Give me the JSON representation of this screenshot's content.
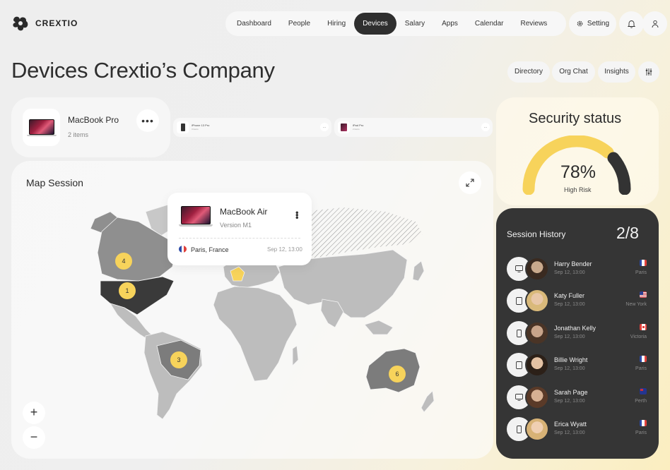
{
  "brand": {
    "name": "CREXTIO"
  },
  "nav": {
    "items": [
      "Dashboard",
      "People",
      "Hiring",
      "Devices",
      "Salary",
      "Apps",
      "Calendar",
      "Reviews"
    ],
    "active": "Devices",
    "setting_label": "Setting",
    "icons": [
      "gear-icon",
      "bell-icon",
      "user-icon"
    ]
  },
  "page": {
    "title": "Devices Crextio’s Company",
    "chips": [
      "Directory",
      "Org Chat",
      "Insights"
    ]
  },
  "device": {
    "name": "MacBook Pro",
    "count": "2 items"
  },
  "small_devices": [
    {
      "name": "iPhone 13 Pro",
      "sub": "3 items"
    },
    {
      "name": "iPad Pro",
      "sub": "2 items"
    }
  ],
  "map": {
    "title": "Map Session",
    "popup": {
      "name": "MacBook Air",
      "version": "Version M1",
      "city": "Paris, France",
      "date": "Sep 12, 13:00"
    },
    "markers": [
      "4",
      "1",
      "3",
      "6"
    ],
    "zoom_in": "+",
    "zoom_out": "−"
  },
  "security": {
    "title": "Security status",
    "value": "78%",
    "label": "High Risk",
    "level": 0.78,
    "colors": {
      "fill": "#f7d35b",
      "risk": "#333333"
    }
  },
  "history": {
    "title": "Session History",
    "count": "2/8",
    "rows": [
      {
        "name": "Harry Bender",
        "date": "Sep 12, 13:00",
        "city": "Paris",
        "device": "monitor-icon",
        "flag": "fr"
      },
      {
        "name": "Katy Fuller",
        "date": "Sep 12, 13:00",
        "city": "New York",
        "device": "tablet-icon",
        "flag": "us"
      },
      {
        "name": "Jonathan Kelly",
        "date": "Sep 12, 13:00",
        "city": "Victoria",
        "device": "phone-icon",
        "flag": "ca"
      },
      {
        "name": "Billie Wright",
        "date": "Sep 12, 13:00",
        "city": "Paris",
        "device": "tablet-icon",
        "flag": "fr"
      },
      {
        "name": "Sarah Page",
        "date": "Sep 12, 13:00",
        "city": "Perth",
        "device": "monitor-icon",
        "flag": "au"
      },
      {
        "name": "Erica Wyatt",
        "date": "Sep 12, 13:00",
        "city": "Paris",
        "device": "phone-icon",
        "flag": "fr"
      }
    ]
  }
}
